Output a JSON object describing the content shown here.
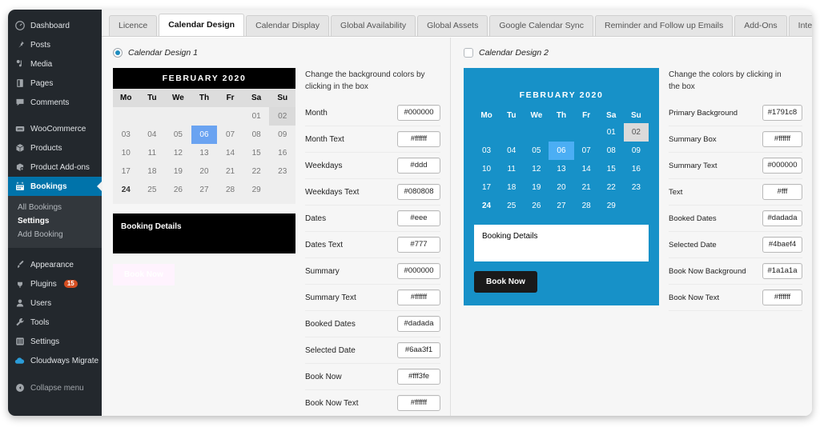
{
  "sidebar": {
    "items": [
      {
        "label": "Dashboard",
        "icon": "dashboard-icon"
      },
      {
        "label": "Posts",
        "icon": "pin-icon"
      },
      {
        "label": "Media",
        "icon": "media-icon"
      },
      {
        "label": "Pages",
        "icon": "page-icon"
      },
      {
        "label": "Comments",
        "icon": "comment-icon"
      },
      {
        "label": "WooCommerce",
        "icon": "woocommerce-icon"
      },
      {
        "label": "Products",
        "icon": "products-icon"
      },
      {
        "label": "Product Add-ons",
        "icon": "product-addons-icon"
      },
      {
        "label": "Bookings",
        "icon": "calendar-icon"
      }
    ],
    "submenu": [
      {
        "label": "All Bookings"
      },
      {
        "label": "Settings"
      },
      {
        "label": "Add Booking"
      }
    ],
    "items2": [
      {
        "label": "Appearance",
        "icon": "brush-icon"
      },
      {
        "label": "Plugins",
        "icon": "plug-icon",
        "badge": "15"
      },
      {
        "label": "Users",
        "icon": "users-icon"
      },
      {
        "label": "Tools",
        "icon": "wrench-icon"
      },
      {
        "label": "Settings",
        "icon": "settings-icon"
      },
      {
        "label": "Cloudways Migrate",
        "icon": "cloud-icon"
      }
    ],
    "collapse": {
      "label": "Collapse menu",
      "icon": "collapse-icon"
    }
  },
  "tabs": [
    {
      "label": "Licence"
    },
    {
      "label": "Calendar Design"
    },
    {
      "label": "Calendar Display"
    },
    {
      "label": "Global Availability"
    },
    {
      "label": "Global Assets"
    },
    {
      "label": "Google Calendar Sync"
    },
    {
      "label": "Reminder and Follow up Emails"
    },
    {
      "label": "Add-Ons"
    },
    {
      "label": "Integrations"
    }
  ],
  "design1": {
    "choice_label": "Calendar Design 1",
    "calendar": {
      "month": "FEBRUARY 2020",
      "weekdays": [
        "Mo",
        "Tu",
        "We",
        "Th",
        "Fr",
        "Sa",
        "Su"
      ],
      "cells": [
        "",
        "",
        "",
        "",
        "",
        "01",
        "02",
        "03",
        "04",
        "05",
        "06",
        "07",
        "08",
        "09",
        "10",
        "11",
        "12",
        "13",
        "14",
        "15",
        "16",
        "17",
        "18",
        "19",
        "20",
        "21",
        "22",
        "23",
        "24",
        "25",
        "26",
        "27",
        "28",
        "29",
        ""
      ],
      "booked_index": 6,
      "selected_index": 10,
      "today_index": 28,
      "summary_label": "Booking Details",
      "book_now_label": "Book Now"
    },
    "hint": "Change the background colors by clicking in the box",
    "options": [
      {
        "label": "Month",
        "value": "#000000"
      },
      {
        "label": "Month Text",
        "value": "#ffffff"
      },
      {
        "label": "Weekdays",
        "value": "#ddd"
      },
      {
        "label": "Weekdays Text",
        "value": "#080808"
      },
      {
        "label": "Dates",
        "value": "#eee"
      },
      {
        "label": "Dates Text",
        "value": "#777"
      },
      {
        "label": "Summary",
        "value": "#000000"
      },
      {
        "label": "Summary Text",
        "value": "#ffffff"
      },
      {
        "label": "Booked Dates",
        "value": "#dadada"
      },
      {
        "label": "Selected Date",
        "value": "#6aa3f1"
      },
      {
        "label": "Book Now",
        "value": "#fff3fe"
      },
      {
        "label": "Book Now Text",
        "value": "#ffffff"
      }
    ]
  },
  "design2": {
    "choice_label": "Calendar Design 2",
    "calendar": {
      "month": "FEBRUARY 2020",
      "weekdays": [
        "Mo",
        "Tu",
        "We",
        "Th",
        "Fr",
        "Sa",
        "Su"
      ],
      "cells": [
        "",
        "",
        "",
        "",
        "",
        "01",
        "02",
        "03",
        "04",
        "05",
        "06",
        "07",
        "08",
        "09",
        "10",
        "11",
        "12",
        "13",
        "14",
        "15",
        "16",
        "17",
        "18",
        "19",
        "20",
        "21",
        "22",
        "23",
        "24",
        "25",
        "26",
        "27",
        "28",
        "29",
        ""
      ],
      "booked_index": 6,
      "selected_index": 10,
      "today_index": 28,
      "summary_label": "Booking Details",
      "book_now_label": "Book Now"
    },
    "hint": "Change the colors by clicking in the box",
    "options": [
      {
        "label": "Primary Background",
        "value": "#1791c8"
      },
      {
        "label": "Summary Box",
        "value": "#ffffff"
      },
      {
        "label": "Summary Text",
        "value": "#000000"
      },
      {
        "label": "Text",
        "value": "#fff"
      },
      {
        "label": "Booked Dates",
        "value": "#dadada"
      },
      {
        "label": "Selected Date",
        "value": "#4baef4"
      },
      {
        "label": "Book Now Background",
        "value": "#1a1a1a"
      },
      {
        "label": "Book Now Text",
        "value": "#ffffff"
      }
    ]
  }
}
